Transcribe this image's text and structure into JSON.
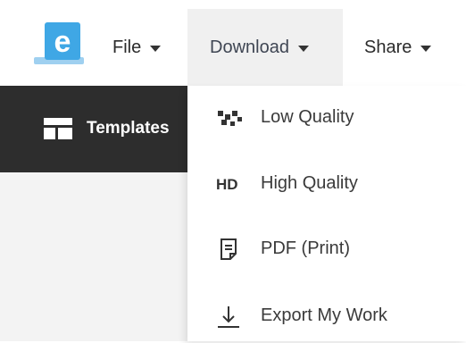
{
  "menubar": {
    "file_label": "File",
    "download_label": "Download",
    "share_label": "Share"
  },
  "sidebar": {
    "templates_label": "Templates"
  },
  "download_menu": {
    "items": [
      {
        "label": "Low Quality",
        "icon": "pixel-icon"
      },
      {
        "label": "High Quality",
        "icon": "hd-icon",
        "icon_text": "HD"
      },
      {
        "label": "PDF (Print)",
        "icon": "pdf-document-icon"
      },
      {
        "label": "Export My Work",
        "icon": "download-arrow-icon"
      }
    ]
  },
  "colors": {
    "logo_blue": "#3fa7e5",
    "logo_light": "#9fd0f0",
    "dark_panel": "#2d2d2d",
    "active_tab_bg": "#f0f0f0"
  }
}
